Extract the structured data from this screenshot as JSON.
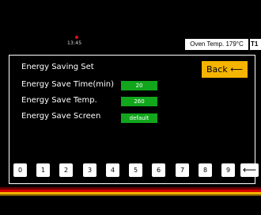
{
  "status": {
    "time": "13:45"
  },
  "header": {
    "oven_temp": "Oven Temp. 179°C",
    "tag": "T1"
  },
  "page": {
    "title": "Energy Saving Set",
    "back_label": "Back ⟵",
    "settings": [
      {
        "label": "Energy Save Time(min)",
        "value": "20"
      },
      {
        "label": "Energy Save Temp.",
        "value": "260"
      },
      {
        "label": "Energy Save Screen",
        "value": "default"
      }
    ]
  },
  "keypad": {
    "keys": [
      "0",
      "1",
      "2",
      "3",
      "4",
      "5",
      "6",
      "7",
      "8",
      "9"
    ],
    "backspace": "⟵"
  },
  "colors": {
    "accent": "#f4b400",
    "value_bg": "#11a61c",
    "stripe_red": "#d40000",
    "stripe_gold": "#f0b000"
  }
}
